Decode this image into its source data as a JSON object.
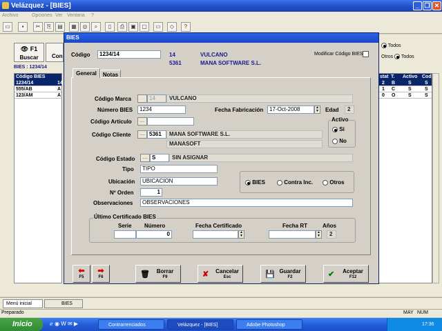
{
  "window": {
    "title": "Velázquez - [BIES]"
  },
  "menu": [
    "Archivo",
    "Opciones",
    "Ver",
    "Ventana",
    "?"
  ],
  "toolbar_icons": [
    "open-icon",
    "save-icon",
    "cut-icon",
    "copy-icon",
    "paste-icon",
    "grid-icon",
    "find-icon",
    "zoom-icon",
    "print-icon",
    "preview-icon",
    "page-icon",
    "monitor-icon",
    "eraser-icon",
    "help-icon"
  ],
  "background": {
    "search_label": "F1",
    "search_sub": "Buscar",
    "con_label": "Con",
    "breadcrumb": "BIES : 1234/14",
    "grid_header": "Código BIES",
    "rows": [
      "1234/14",
      "555/AB",
      "123/AM"
    ],
    "row_col2": [
      "14",
      "A",
      "A"
    ],
    "right_options": [
      "Todos",
      "Todos"
    ],
    "otros_label": "Otros",
    "right_headers": [
      "stat",
      "T.",
      "Activo",
      "Cod"
    ],
    "right_rows": [
      [
        "2",
        "B",
        "S",
        "S"
      ],
      [
        "1",
        "C",
        "S",
        "S"
      ],
      [
        "0",
        "O",
        "S",
        "S"
      ]
    ]
  },
  "dialog": {
    "title": "BIES",
    "codigo_label": "Código",
    "codigo_value": "1234/14",
    "codigo_id1": "14",
    "codigo_name1": "VULCANO",
    "codigo_id2": "5361",
    "codigo_name2": "MANA SOFTWARE S.L.",
    "modificar_label": "Modificar Código BIES",
    "tabs": [
      "General",
      "Notas"
    ],
    "marca_label": "Código Marca",
    "marca_value": "14",
    "marca_name": "VULCANO",
    "numero_label": "Número BIES",
    "numero_value": "1234",
    "fecha_fab_label": "Fecha Fabricación",
    "fecha_fab_value": "17-Oct-2008",
    "edad_label": "Edad",
    "edad_value": "2",
    "articulo_label": "Código Artículo",
    "cliente_label": "Código Cliente",
    "cliente_value": "5361",
    "cliente_name": "MANA SOFTWARE S.L.",
    "cliente_name2": "MANASOFT",
    "activo_label": "Activo",
    "activo_si": "Si",
    "activo_no": "No",
    "estado_label": "Código Estado",
    "estado_value": "S",
    "estado_name": "SIN ASIGNAR",
    "tipo_label": "Tipo",
    "tipo_value": "TIPO",
    "ubicacion_label": "Ubicación",
    "ubicacion_value": "UBICACION",
    "orden_label": "Nº Orden",
    "orden_value": "1",
    "obs_label": "Observaciones",
    "obs_value": "OBSERVACIONES",
    "radio_options": [
      "BIES",
      "Contra Inc.",
      "Otros"
    ],
    "cert_group_label": "Último Certificado BIES",
    "cert_serie_label": "Serie",
    "cert_numero_label": "Número",
    "cert_numero_value": "0",
    "cert_fecha_label": "Fecha Certificado",
    "cert_fecha_rt_label": "Fecha RT",
    "cert_anos_label": "Años",
    "cert_anos_value": "2",
    "buttons": {
      "prev_key": "F5",
      "next_key": "F6",
      "borrar": "Borrar",
      "borrar_key": "F9",
      "cancelar": "Cancelar",
      "cancelar_key": "Esc",
      "guardar": "Guardar",
      "guardar_key": "F2",
      "aceptar": "Aceptar",
      "aceptar_key": "F12"
    }
  },
  "bottom_tabs": [
    "Menú inicial",
    "BIES"
  ],
  "status": {
    "text": "Preparado",
    "caps": "MAY",
    "num": "NUM"
  },
  "taskbar": {
    "start": "Inicio",
    "tasks": [
      "Contrarrenciados",
      "Velázquez - [BIES]",
      "Adobe Photoshop"
    ],
    "clock": "17:36"
  }
}
